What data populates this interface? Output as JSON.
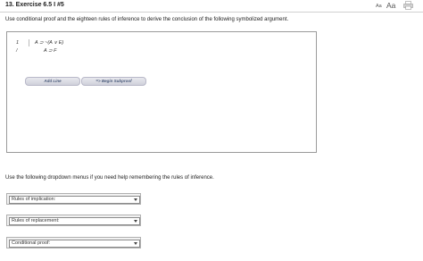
{
  "header": {
    "exercise_title": "13.  Exercise 6.5 I #5",
    "text_size_small": "Aa",
    "text_size_large": "Aa",
    "print_icon": "printer-icon"
  },
  "instructions": "Use conditional proof and the eighteen rules of inference to derive the conclusion of the following symbolized argument.",
  "proof": {
    "lines": [
      {
        "number": "1",
        "formula": "A ⊃ ~(A ∨ E)"
      },
      {
        "number": "/",
        "formula": "A ⊃ F"
      }
    ],
    "add_line_label": "Add Line",
    "begin_subproof_label": "=> Begin Subproof"
  },
  "dropdown_intro": "Use the following dropdown menus if you need help remembering the rules of inference.",
  "dropdowns": [
    {
      "selected": "Rules of implication:"
    },
    {
      "selected": "Rules of replacement:"
    },
    {
      "selected": "Conditional proof:"
    }
  ]
}
